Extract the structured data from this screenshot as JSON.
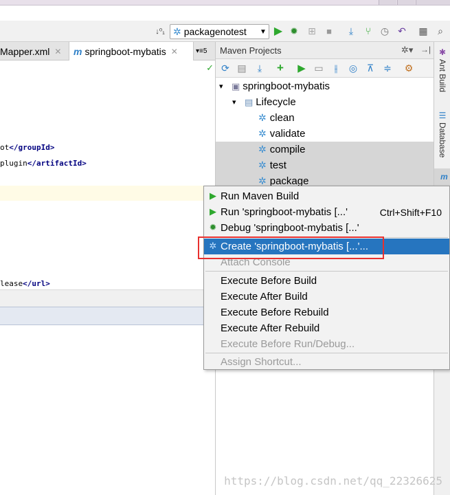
{
  "toolbar": {
    "run_config": "packagenotest"
  },
  "editor": {
    "tabs": [
      {
        "label": "Mapper.xml"
      },
      {
        "label": "springboot-mybatis"
      }
    ],
    "tab_overflow": "5",
    "code_lines": [
      {
        "text": "ot",
        "tag": "groupId"
      },
      {
        "text": "plugin",
        "tag": "artifactId"
      },
      {
        "text": "lease",
        "tag": "url"
      }
    ]
  },
  "maven": {
    "title": "Maven Projects",
    "tree": {
      "project": "springboot-mybatis",
      "lifecycle": "Lifecycle",
      "phases": [
        "clean",
        "validate",
        "compile",
        "test",
        "package"
      ]
    }
  },
  "side_tabs": [
    "Ant Build",
    "Database",
    "m"
  ],
  "context_menu": {
    "items": [
      {
        "label": "Run Maven Build",
        "shortcut": "",
        "disabled": false,
        "icon": "run-icon"
      },
      {
        "label": "Run 'springboot-mybatis [...'",
        "shortcut": "Ctrl+Shift+F10",
        "disabled": false,
        "icon": "run-icon"
      },
      {
        "label": "Debug 'springboot-mybatis [...'",
        "shortcut": "",
        "disabled": false,
        "icon": "debug-icon"
      },
      {
        "label": "Create 'springboot-mybatis [...'...",
        "shortcut": "",
        "disabled": false,
        "icon": "gear-icon",
        "highlighted": true
      },
      {
        "label": "Attach Console",
        "shortcut": "",
        "disabled": true
      },
      {
        "label": "Execute Before Build",
        "shortcut": "",
        "disabled": false
      },
      {
        "label": "Execute After Build",
        "shortcut": "",
        "disabled": false
      },
      {
        "label": "Execute Before Rebuild",
        "shortcut": "",
        "disabled": false
      },
      {
        "label": "Execute After Rebuild",
        "shortcut": "",
        "disabled": false
      },
      {
        "label": "Execute Before Run/Debug...",
        "shortcut": "",
        "disabled": true
      },
      {
        "label": "Assign Shortcut...",
        "shortcut": "",
        "disabled": true
      }
    ]
  },
  "watermark": "https://blog.csdn.net/qq_22326625",
  "colors": {
    "highlight": "#2675bf",
    "run_green": "#2ea82e",
    "gear_blue": "#3d8fd1",
    "annotation_red": "#e8302e"
  }
}
